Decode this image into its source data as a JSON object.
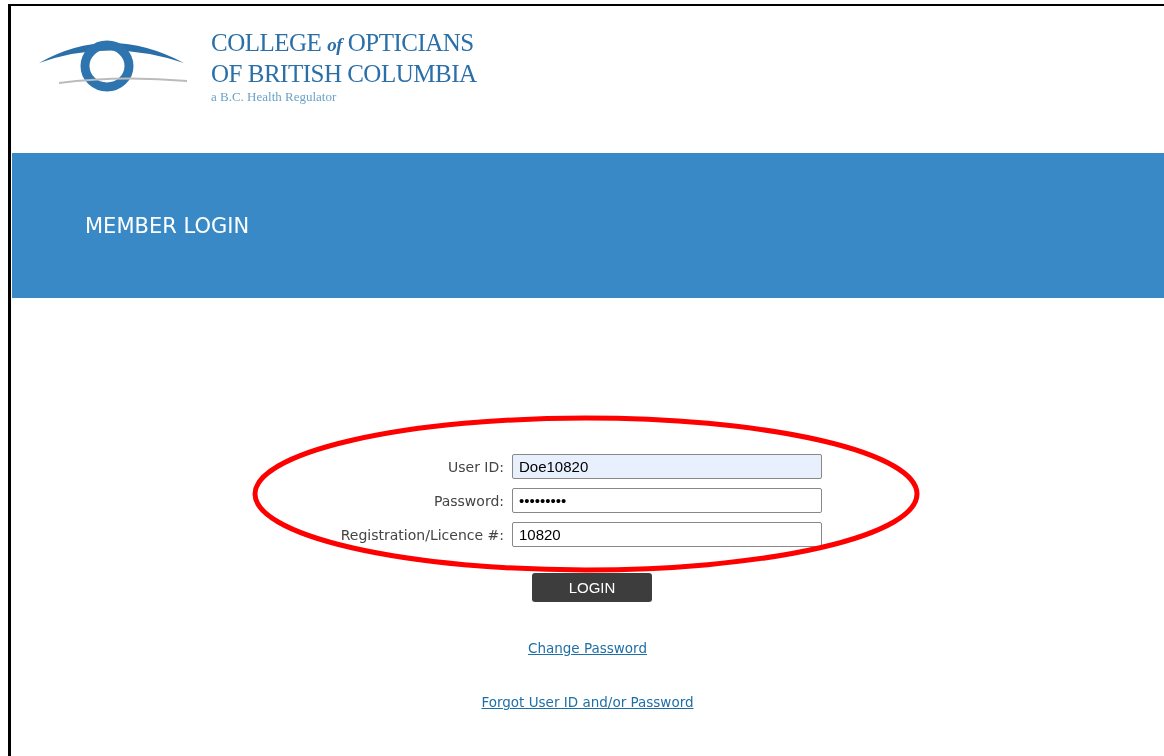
{
  "logo": {
    "line_1_before": "COLLEGE",
    "line_1_italic": "of",
    "line_1_after": "OPTICIANS",
    "line_2": "OF BRITISH COLUMBIA",
    "tagline": "a B.C. Health Regulator"
  },
  "banner": {
    "title": "MEMBER LOGIN"
  },
  "form": {
    "fields": [
      {
        "label": "User ID:",
        "value": "Doe10820",
        "highlighted": true
      },
      {
        "label": "Password:",
        "value": "•••••••••",
        "highlighted": false
      },
      {
        "label": "Registration/Licence #:",
        "value": "10820",
        "highlighted": false
      }
    ],
    "annotation": {
      "kind": "ellipse"
    },
    "button": "LOGIN"
  },
  "links": [
    "Change Password",
    "Forgot User ID and/or Password"
  ]
}
